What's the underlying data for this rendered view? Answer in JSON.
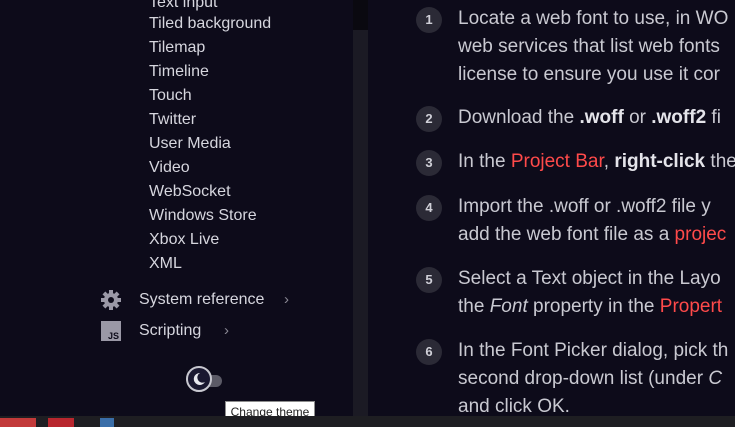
{
  "sidebar": {
    "sub_items": [
      "Text input",
      "Tiled background",
      "Tilemap",
      "Timeline",
      "Touch",
      "Twitter",
      "User Media",
      "Video",
      "WebSocket",
      "Windows Store",
      "Xbox Live",
      "XML"
    ],
    "sections": [
      {
        "label": "System reference",
        "icon": "gear-icon"
      },
      {
        "label": "Scripting",
        "icon": "js-icon"
      }
    ],
    "chevron": "›"
  },
  "theme": {
    "tooltip": "Change theme"
  },
  "steps": [
    {
      "num": "1",
      "lines": [
        [
          "Locate a web font to use, in WO"
        ],
        [
          "web services that list web fonts"
        ],
        [
          "license to ensure you use it cor"
        ]
      ]
    },
    {
      "num": "2",
      "lines": [
        [
          "Download the ",
          "n"
        ],
        [
          ".woff",
          "b"
        ],
        [
          " or ",
          "n"
        ],
        [
          ".woff2",
          "b"
        ],
        [
          " fi",
          "n"
        ]
      ]
    },
    {
      "num": "3",
      "lines": [
        [
          "In the ",
          "n"
        ],
        [
          "Project Bar",
          "h"
        ],
        [
          ", ",
          "n"
        ],
        [
          "right-click",
          "b"
        ],
        [
          " the",
          "n"
        ]
      ]
    },
    {
      "num": "4",
      "lines": [
        [
          "Import the .woff or .woff2 file y"
        ],
        [
          "add the web font file as a ",
          "n",
          "projec"
        ]
      ]
    },
    {
      "num": "5",
      "lines": [
        [
          "Select a Text object in the Layo"
        ],
        [
          "the ",
          "n",
          "Font",
          "property in the ",
          "Propert"
        ]
      ]
    },
    {
      "num": "6",
      "lines": [
        [
          "In the Font Picker dialog, pick th"
        ],
        [
          "second drop-down list (under ",
          "n",
          "C"
        ],
        [
          "and click OK."
        ]
      ]
    }
  ],
  "step_text": {
    "s1": [
      "Locate a web font to use, in WO",
      "web services that list web fonts",
      "license to ensure you use it cor"
    ],
    "s2": {
      "a": "Download the ",
      "b": ".woff",
      "c": " or ",
      "d": ".woff2",
      "e": " fi"
    },
    "s3": {
      "a": "In the ",
      "b": "Project Bar",
      "c": ", ",
      "d": "right-click",
      "e": " the"
    },
    "s4": {
      "l1": "Import the .woff or .woff2 file y",
      "l2a": "add the web font file as a ",
      "l2b": "projec"
    },
    "s5": {
      "l1": "Select a Text object in the Layo",
      "l2a": "the ",
      "l2b": "Font",
      "l2c": " property in the ",
      "l2d": "Propert"
    },
    "s6": {
      "l1": "In the Font Picker dialog, pick th",
      "l2a": "second drop-down list (under ",
      "l2b": "C",
      "l3": "and click OK."
    }
  },
  "colors": {
    "accent": "#ff4a4a",
    "background": "#0d0b1a"
  }
}
